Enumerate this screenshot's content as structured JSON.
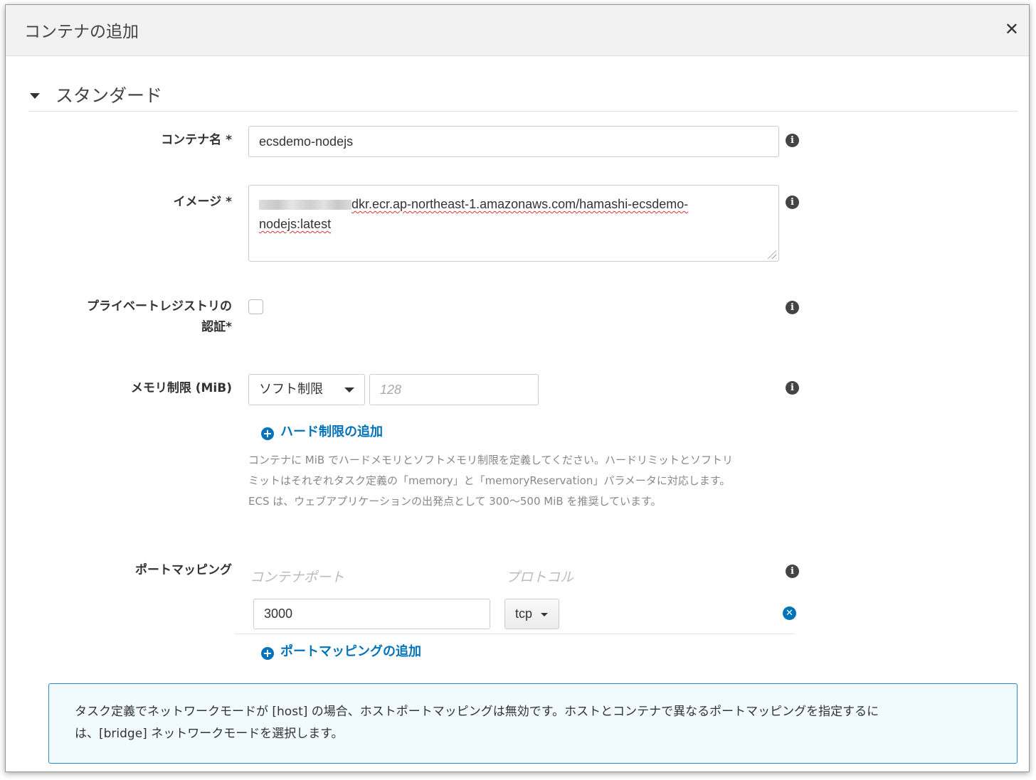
{
  "dialog": {
    "title": "コンテナの追加",
    "close_glyph": "✕"
  },
  "section": {
    "title": "スタンダード"
  },
  "fields": {
    "container_name": {
      "label": "コンテナ名 *",
      "value": "ecsdemo-nodejs"
    },
    "image": {
      "label": "イメージ *",
      "value_visible_line1": "dkr.ecr.ap-northeast-1.amazonaws.com/hamashi-ecsdemo-",
      "value_visible_line2": "nodejs:latest"
    },
    "private_registry": {
      "label_line1": "プライベートレジストリの",
      "label_line2": "認証*",
      "checked": false
    },
    "memory": {
      "label": "メモリ制限 (MiB)",
      "limit_type": "ソフト制限",
      "placeholder": "128",
      "add_hard_limit": "ハード制限の追加",
      "help_line1": "コンテナに MiB でハードメモリとソフトメモリ制限を定義してください。ハードリミットとソフトリ",
      "help_line2": "ミットはそれぞれタスク定義の「memory」と「memoryReservation」パラメータに対応します。",
      "help_line3": "ECS は、ウェブアプリケーションの出発点として 300〜500 MiB を推奨しています。"
    },
    "port_mapping": {
      "label": "ポートマッピング",
      "col_container_port": "コンテナポート",
      "col_protocol": "プロトコル",
      "rows": [
        {
          "container_port": "3000",
          "protocol": "tcp"
        }
      ],
      "add_label": "ポートマッピングの追加"
    }
  },
  "notice": {
    "line1": "タスク定義でネットワークモードが [host] の場合、ホストポートマッピングは無効です。ホストとコンテナで異なるポートマッピングを指定するに",
    "line2": "は、[bridge] ネットワークモードを選択します。"
  },
  "icons": {
    "info": "info-circle-icon",
    "plus": "plus-circle-icon",
    "remove": "remove-circle-icon"
  },
  "colors": {
    "link": "#0073bb",
    "notice_border": "#2a88c8",
    "notice_bg": "#f1faff"
  }
}
